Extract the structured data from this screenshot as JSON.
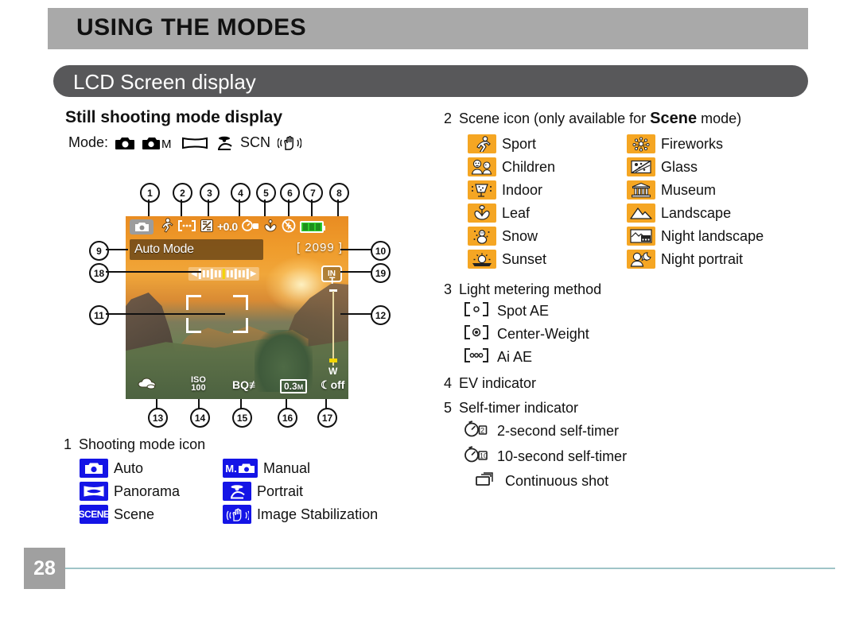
{
  "header": {
    "chapter_title": "USING THE MODES",
    "section_title": "LCD Screen display"
  },
  "left_column": {
    "subhead": "Still shooting mode display",
    "mode_label": "Mode:",
    "mode_icons": [
      "camera-auto-icon",
      "camera-manual-M-icon",
      "panorama-icon",
      "portrait-icon",
      "SCN",
      "image-stabilization-icon"
    ],
    "mode_scn_text": "SCN"
  },
  "lcd": {
    "mode_text": "Auto Mode",
    "shots_remaining": "[ 2099 ]",
    "ev_value": "+0.0",
    "memory_badge": "IN",
    "zoom_tele": "T",
    "zoom_wide": "W",
    "iso_top": "ISO",
    "iso_bottom": "100",
    "quality_text": "BQ",
    "resolution_text": "0.3",
    "resolution_unit": "M",
    "face_detect_text": "off"
  },
  "callouts": [
    {
      "n": "1"
    },
    {
      "n": "2"
    },
    {
      "n": "3"
    },
    {
      "n": "4"
    },
    {
      "n": "5"
    },
    {
      "n": "6"
    },
    {
      "n": "7"
    },
    {
      "n": "8"
    },
    {
      "n": "9"
    },
    {
      "n": "10"
    },
    {
      "n": "11"
    },
    {
      "n": "12"
    },
    {
      "n": "13"
    },
    {
      "n": "14"
    },
    {
      "n": "15"
    },
    {
      "n": "16"
    },
    {
      "n": "17"
    },
    {
      "n": "18"
    },
    {
      "n": "19"
    }
  ],
  "legend": {
    "item1": {
      "num": "1",
      "title": "Shooting mode icon",
      "left": [
        {
          "icon": "camera-auto-icon",
          "label": "Auto"
        },
        {
          "icon": "panorama-icon",
          "label": "Panorama"
        },
        {
          "icon": "scene-icon",
          "label": "Scene",
          "chip_text": "SCENE"
        }
      ],
      "right": [
        {
          "icon": "camera-manual-icon",
          "label": "Manual",
          "chip_text": "M."
        },
        {
          "icon": "portrait-icon",
          "label": "Portrait"
        },
        {
          "icon": "image-stabilization-icon",
          "label": "Image Stabilization"
        }
      ]
    },
    "item2": {
      "num": "2",
      "title_pre": "Scene icon (only available for ",
      "title_bold": "Scene",
      "title_post": " mode)",
      "left": [
        {
          "icon": "sport-icon",
          "label": "Sport"
        },
        {
          "icon": "children-icon",
          "label": "Children"
        },
        {
          "icon": "indoor-icon",
          "label": "Indoor"
        },
        {
          "icon": "leaf-icon",
          "label": "Leaf"
        },
        {
          "icon": "snow-icon",
          "label": "Snow"
        },
        {
          "icon": "sunset-icon",
          "label": "Sunset"
        }
      ],
      "right": [
        {
          "icon": "fireworks-icon",
          "label": "Fireworks"
        },
        {
          "icon": "glass-icon",
          "label": "Glass"
        },
        {
          "icon": "museum-icon",
          "label": "Museum"
        },
        {
          "icon": "landscape-icon",
          "label": "Landscape"
        },
        {
          "icon": "night-landscape-icon",
          "label": "Night landscape"
        },
        {
          "icon": "night-portrait-icon",
          "label": "Night portrait"
        }
      ]
    },
    "item3": {
      "num": "3",
      "title": "Light metering method",
      "rows": [
        {
          "icon": "spot-ae-icon",
          "label": "Spot AE"
        },
        {
          "icon": "center-weight-icon",
          "label": "Center-Weight"
        },
        {
          "icon": "ai-ae-icon",
          "label": "Ai AE"
        }
      ]
    },
    "item4": {
      "num": "4",
      "title": "EV indicator"
    },
    "item5": {
      "num": "5",
      "title": "Self-timer indicator",
      "rows": [
        {
          "icon": "self-timer-2s-icon",
          "label": "2-second self-timer"
        },
        {
          "icon": "self-timer-10s-icon",
          "label": "10-second self-timer"
        },
        {
          "icon": "continuous-shot-icon",
          "label": "Continuous shot"
        }
      ]
    }
  },
  "footer": {
    "page_number": "28"
  },
  "colors": {
    "chapter_bar": "#a9a9a9",
    "section_bar": "#58585a",
    "mode_chip_blue": "#1414e6",
    "scene_chip_amber": "#f5a623",
    "footer_rule": "#9fc4c8",
    "page_box": "#a0a0a0"
  }
}
